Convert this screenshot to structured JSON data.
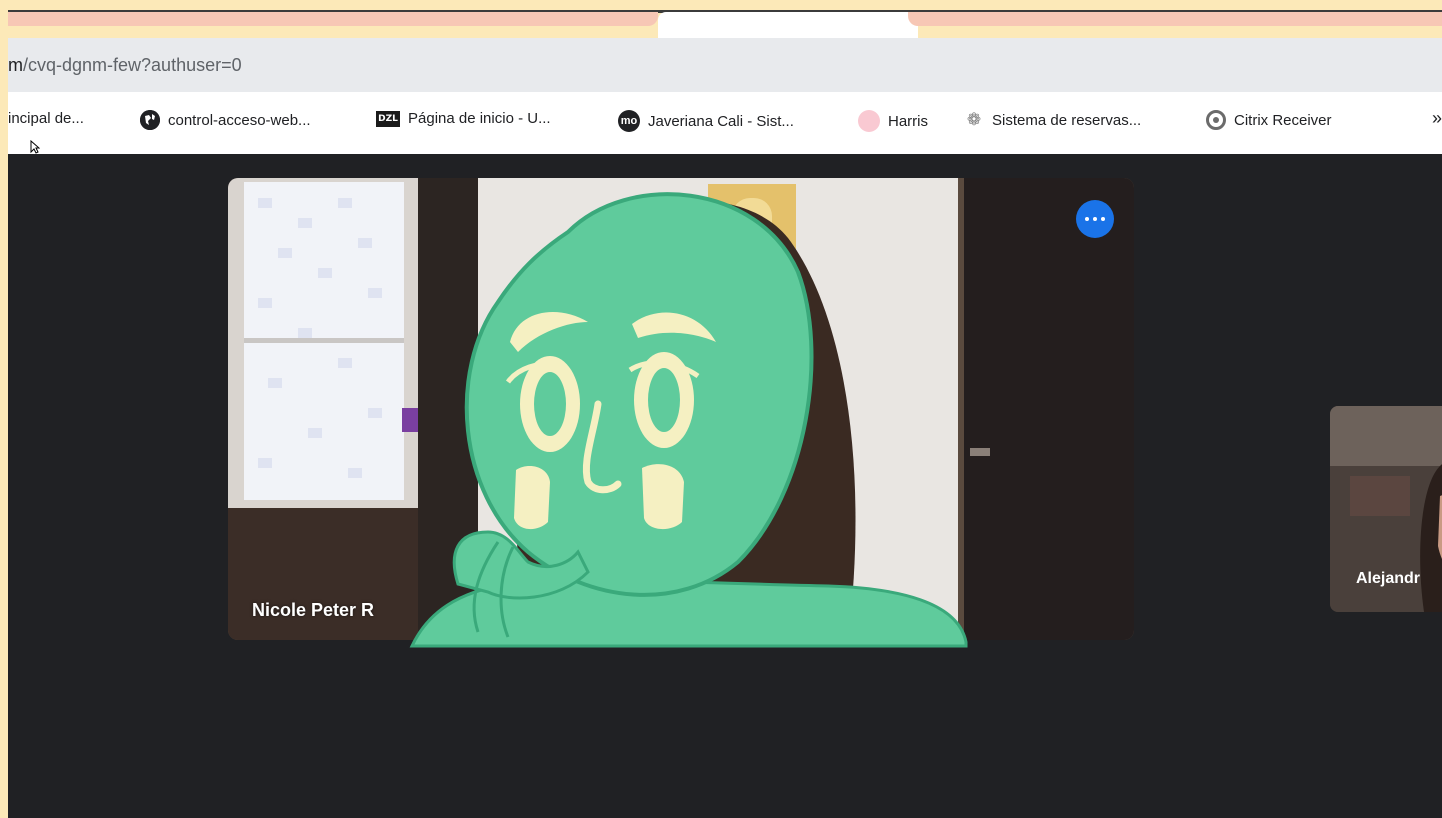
{
  "browser": {
    "url_host_fragment": "m",
    "url_path": "/cvq-dgnm-few?authuser=0"
  },
  "bookmarks": [
    {
      "label": "incipal de...",
      "icon": "none"
    },
    {
      "label": "control-acceso-web...",
      "icon": "globe-icon"
    },
    {
      "label": "Página de inicio - U...",
      "icon": "dzl-logo-icon",
      "icon_text": "DZL"
    },
    {
      "label": "Javeriana Cali - Sist...",
      "icon": "mo-logo-icon",
      "icon_text": "mo"
    },
    {
      "label": "Harris",
      "icon": "pink-circle-icon"
    },
    {
      "label": "Sistema de reservas...",
      "icon": "gear-cluster-icon"
    },
    {
      "label": "Citrix Receiver",
      "icon": "citrix-icon"
    }
  ],
  "bookmarks_more": "»",
  "meeting": {
    "main_participant": "Nicole Peter R",
    "side_participant": "Alejandr"
  },
  "colors": {
    "frame": "#fce9b8",
    "meet_background": "#202124",
    "avatar_green": "#5fcb9c",
    "avatar_features": "#f5f0c2",
    "more_button": "#1a73e8"
  }
}
